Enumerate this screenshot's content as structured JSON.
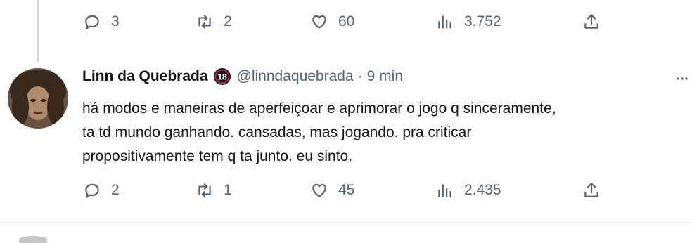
{
  "prev_tweet": {
    "replies": "3",
    "retweets": "2",
    "likes": "60",
    "views": "3.752"
  },
  "tweet": {
    "name": "Linn da Quebrada",
    "badge": "18",
    "handle": "@linndaquebrada",
    "separator": "·",
    "time": "9 min",
    "text_lines": [
      "há modos e maneiras de aperfeiçoar e aprimorar o jogo q sinceramente,",
      "ta td mundo ganhando. cansadas, mas jogando. pra criticar",
      "propositivamente tem q ta junto. eu sinto."
    ],
    "replies": "2",
    "retweets": "1",
    "likes": "45",
    "views": "2.435"
  },
  "colors": {
    "text": "#0f1419",
    "secondary": "#536471",
    "thread_line": "#cfd9de",
    "badge": "#1a1a1a"
  },
  "icons": [
    "reply-icon",
    "retweet-icon",
    "like-icon",
    "views-icon",
    "share-icon",
    "more-icon"
  ]
}
